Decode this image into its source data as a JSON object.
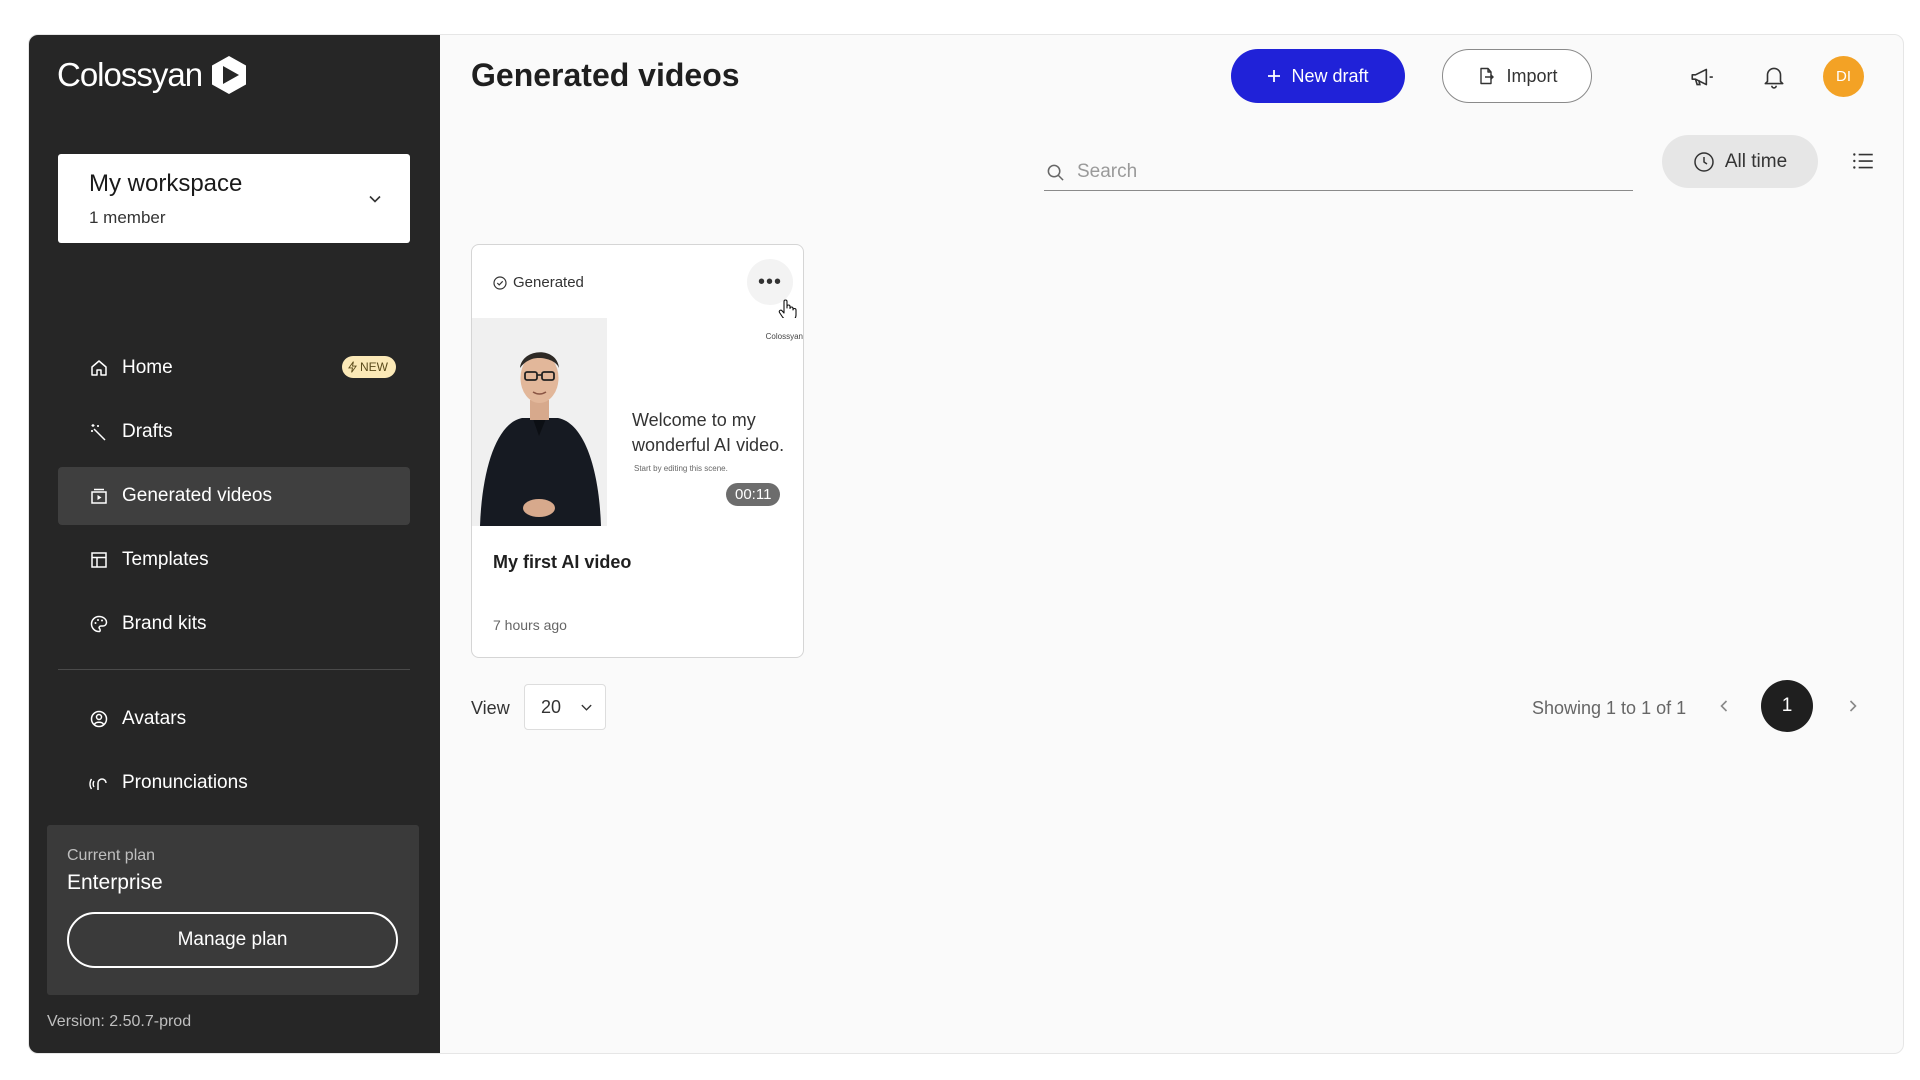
{
  "brand": {
    "name": "Colossyan"
  },
  "workspace": {
    "name": "My workspace",
    "members": "1 member"
  },
  "sidebar": {
    "items": [
      {
        "label": "Home",
        "icon": "home-icon",
        "badge": "NEW"
      },
      {
        "label": "Drafts",
        "icon": "wand-icon"
      },
      {
        "label": "Generated videos",
        "icon": "video-library-icon",
        "active": true
      },
      {
        "label": "Templates",
        "icon": "template-icon"
      },
      {
        "label": "Brand kits",
        "icon": "palette-icon"
      }
    ],
    "secondary_items": [
      {
        "label": "Avatars",
        "icon": "avatar-icon"
      },
      {
        "label": "Pronunciations",
        "icon": "pronunciation-icon"
      }
    ]
  },
  "plan": {
    "label": "Current plan",
    "name": "Enterprise",
    "manage_label": "Manage plan"
  },
  "version": "Version: 2.50.7-prod",
  "header": {
    "title": "Generated videos",
    "new_draft_label": "New draft",
    "import_label": "Import",
    "avatar_initials": "DI"
  },
  "toolbar": {
    "search_placeholder": "Search",
    "time_filter_label": "All time"
  },
  "videos": [
    {
      "status": "Generated",
      "title": "My first AI video",
      "time": "7 hours ago",
      "duration": "00:11",
      "thumbnail": {
        "brand": "Colossyan",
        "slide_title": "Welcome to my wonderful AI video.",
        "slide_subtitle": "Start by editing this scene."
      }
    }
  ],
  "pagination": {
    "view_label": "View",
    "page_size": "20",
    "showing_text": "Showing 1 to 1 of 1",
    "current_page": "1"
  },
  "colors": {
    "accent": "#2022d8",
    "sidebar_bg": "#262626",
    "avatar_bg": "#f3a225"
  }
}
